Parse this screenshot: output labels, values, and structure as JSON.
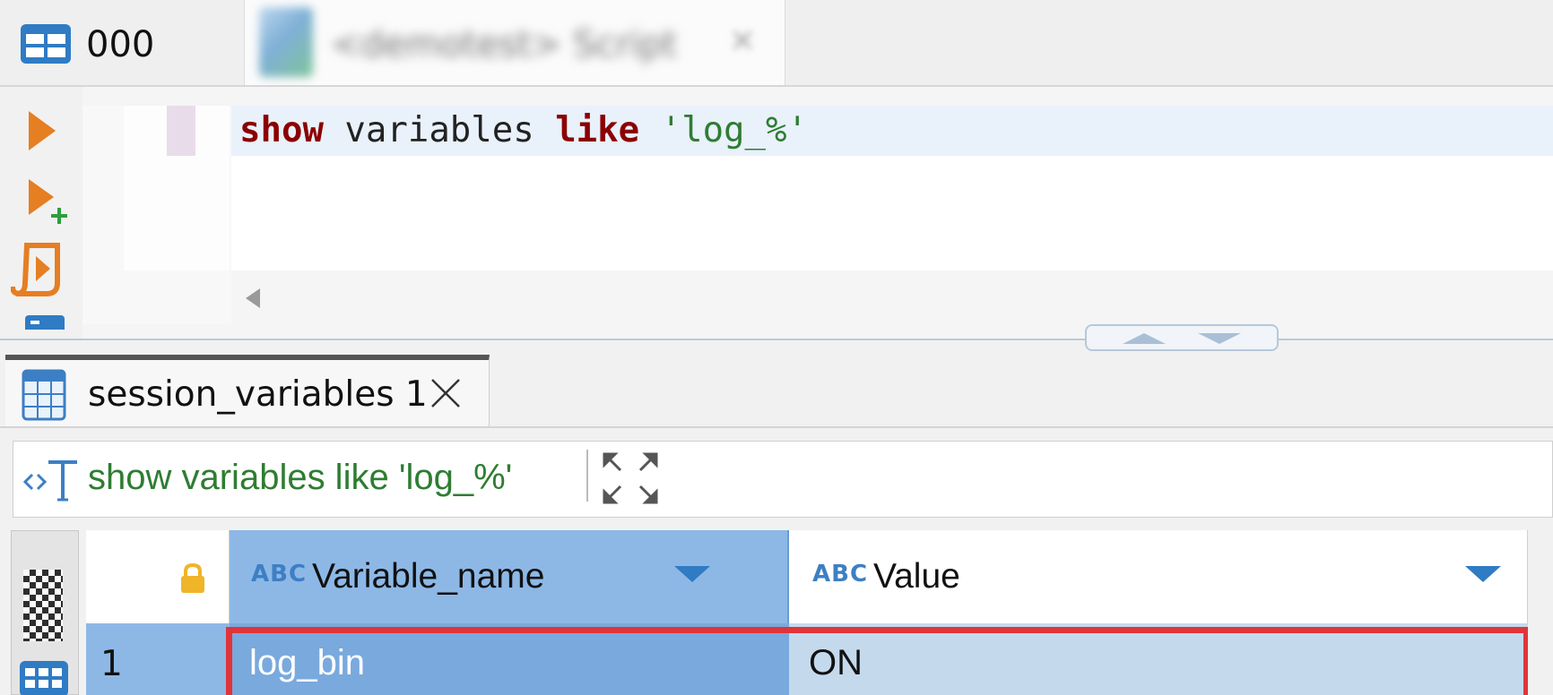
{
  "tabs": [
    {
      "label": "000",
      "icon": "table-icon"
    },
    {
      "label": "<demotest> Script",
      "icon": "script-icon",
      "blurred": true
    }
  ],
  "editor": {
    "sql": {
      "kw1": "show",
      "mid": " variables ",
      "kw2": "like",
      "str": " 'log_%'"
    }
  },
  "toolbar": {
    "run": "execute-statement-icon",
    "run_new_tab": "execute-new-tab-icon",
    "run_script": "execute-script-icon"
  },
  "results": {
    "tab_label": "session_variables 1",
    "query_text": "show variables like 'log_%'",
    "columns": [
      {
        "type_badge": "ABC",
        "name": "Variable_name"
      },
      {
        "type_badge": "ABC",
        "name": "Value"
      }
    ],
    "rows": [
      {
        "num": "1",
        "cells": [
          "log_bin",
          "ON"
        ]
      }
    ]
  },
  "colors": {
    "keyword": "#8b0000",
    "string": "#2e7d32",
    "accent": "#3d7fc4",
    "selected_header": "#8db8e6",
    "highlight": "#e0343a"
  }
}
